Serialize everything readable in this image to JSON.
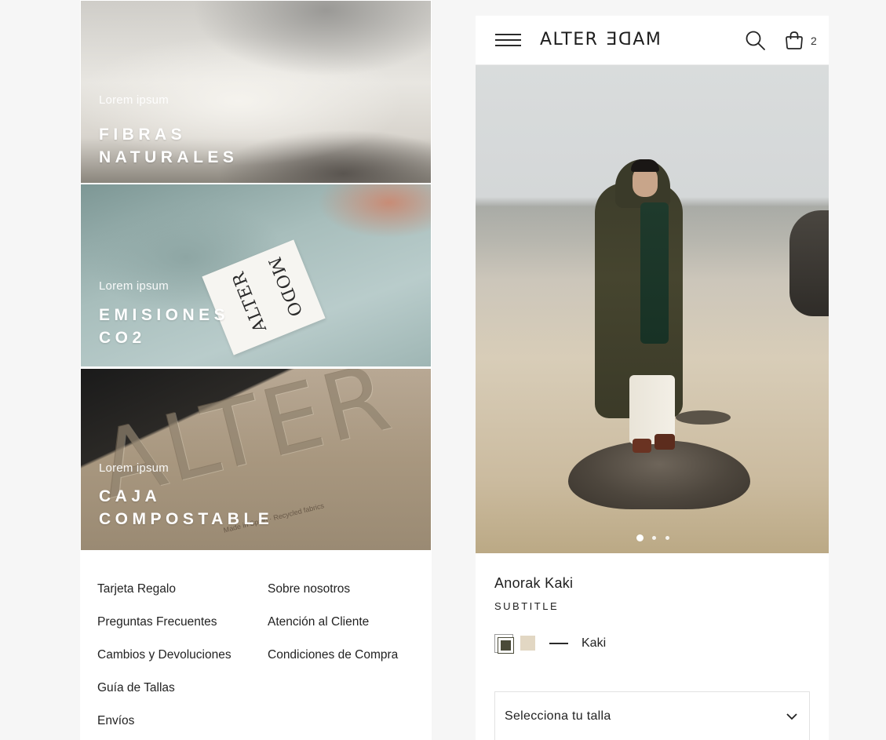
{
  "promo_tiles": [
    {
      "kicker": "Lorem ipsum",
      "headline_line1": "FIBRAS",
      "headline_line2": "NATURALES"
    },
    {
      "kicker": "Lorem ipsum",
      "headline_line1": "EMISIONES",
      "headline_line2": "CO2",
      "tag_text_a": "ALTER",
      "tag_text_b": "MODO"
    },
    {
      "kicker": "Lorem ipsum",
      "headline_line1": "CAJA",
      "headline_line2": "COMPOSTABLE",
      "emboss_text": "ALTER",
      "small_print": "Made in Spain · Recycled fabrics"
    }
  ],
  "footer": {
    "col_a": [
      "Tarjeta Regalo",
      "Preguntas Frecuentes",
      "Cambios y Devoluciones",
      "Guía de Tallas",
      "Envíos"
    ],
    "col_b": [
      "Sobre nosotros",
      "Atención al Cliente",
      "Condiciones de Compra"
    ]
  },
  "header": {
    "logo_left": "ALTER",
    "logo_right": "MADE",
    "cart_count": "2",
    "icons": [
      "hamburger-menu-icon",
      "search-icon",
      "shopping-bag-icon"
    ]
  },
  "gallery": {
    "slide_count": 3,
    "active_slide": 1
  },
  "product": {
    "name": "Anorak Kaki",
    "subtitle": "SUBTITLE",
    "selected_color": "Kaki",
    "colors": [
      {
        "name": "Kaki",
        "hex": "#4a4a38",
        "selected": true
      },
      {
        "name": "Beige",
        "hex": "#e2d7c3",
        "selected": false
      }
    ],
    "size_placeholder": "Selecciona tu talla"
  }
}
